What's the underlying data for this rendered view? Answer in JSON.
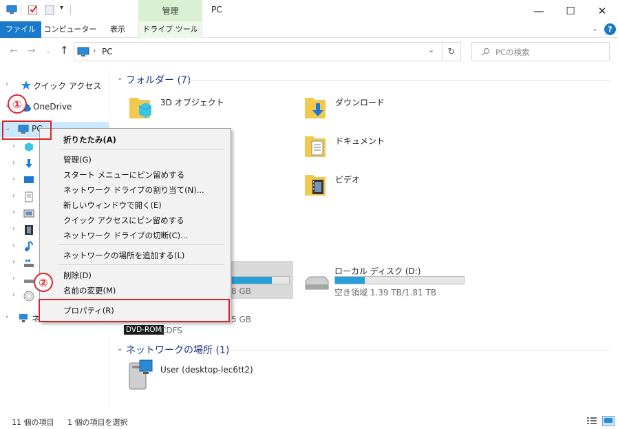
{
  "window": {
    "title": "PC",
    "context_tab_group": "管理",
    "minimize": "—",
    "maximize": "☐",
    "close": "✕"
  },
  "ribbon": {
    "tabs": [
      {
        "label": "ファイル"
      },
      {
        "label": "コンピューター"
      },
      {
        "label": "表示"
      },
      {
        "label": "ドライブ ツール"
      }
    ]
  },
  "address": {
    "path": "PC",
    "search_placeholder": "PCの検索"
  },
  "nav_pane": {
    "quick_access": "クイック アクセス",
    "onedrive": "OneDrive",
    "pc": "PC",
    "network": "ネ"
  },
  "main": {
    "folders_header": "フォルダー (7)",
    "folders": [
      {
        "name": "3D オブジェクト",
        "icon": "3d-objects-folder-icon"
      },
      {
        "name": "ダウンロード",
        "icon": "downloads-folder-icon"
      },
      {
        "name": "ドキュメント",
        "icon": "documents-folder-icon"
      },
      {
        "name": "ビデオ",
        "icon": "videos-folder-icon"
      }
    ],
    "drives": {
      "c_free_fragment": "8 GB",
      "c_used_ratio": 0.7,
      "d_name": "ローカル ディスク (D:)",
      "d_free": "空き領域 1.39 TB/1.81 TB",
      "d_used_ratio": 0.23,
      "dvd_fragment": "5 GB",
      "dvd_badge": "DVD-ROM",
      "dvd_fs": "CDFS"
    },
    "network_header": "ネットワークの場所 (1)",
    "network_items": [
      {
        "name": "User (desktop-lec6tt2)"
      }
    ]
  },
  "context_menu": {
    "collapse": "折りたたみ(A)",
    "manage": "管理(G)",
    "pin_start": "スタート メニューにピン留めする",
    "map_drive": "ネットワーク ドライブの割り当て(N)...",
    "open_new_window": "新しいウィンドウで開く(E)",
    "pin_quick": "クイック アクセスにピン留めする",
    "disconnect_drive": "ネットワーク ドライブの切断(C)...",
    "add_network_location": "ネットワークの場所を追加する(L)",
    "delete": "削除(D)",
    "rename": "名前の変更(M)",
    "properties": "プロパティ(R)"
  },
  "annotations": {
    "step1": "①",
    "step2": "②"
  },
  "status": {
    "item_count": "11 個の項目",
    "selected": "1 個の項目を選択"
  },
  "colors": {
    "accent": "#1979ca",
    "selection": "#cce8ff",
    "annotation_red": "#d9232a",
    "drive_bar": "#26a0da"
  }
}
